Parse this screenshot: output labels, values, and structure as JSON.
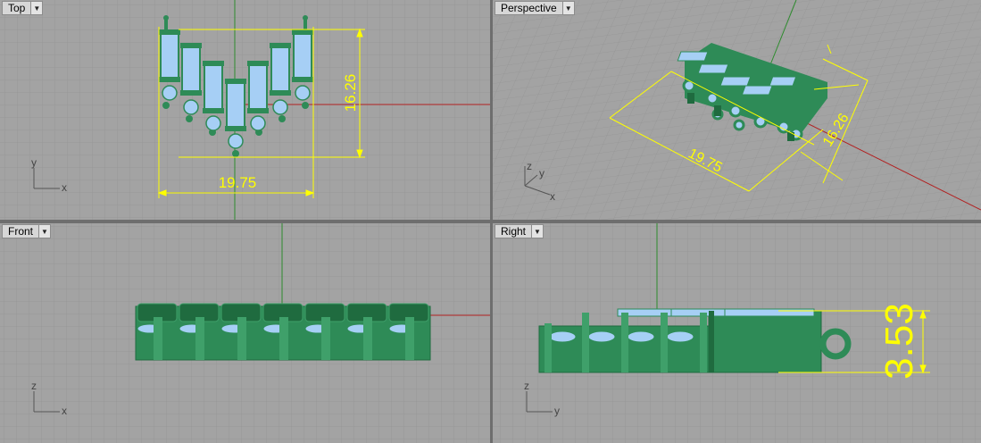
{
  "viewports": {
    "top": {
      "label": "Top",
      "dim_width": "19.75",
      "dim_depth": "16.26",
      "axis_x": "x",
      "axis_y": "y"
    },
    "perspective": {
      "label": "Perspective",
      "dim_width": "19.75",
      "dim_depth": "16.26",
      "axis_x": "x",
      "axis_y": "y",
      "axis_z": "z"
    },
    "front": {
      "label": "Front",
      "axis_x": "x",
      "axis_z": "z"
    },
    "right": {
      "label": "Right",
      "dim_height": "3.53",
      "axis_y": "y",
      "axis_z": "z"
    }
  },
  "colors": {
    "viewport_bg": "#a3a3a3",
    "grid": "#959595",
    "model_green": "#2e8b57",
    "selected_blue": "#a6cff5",
    "dimension_yellow": "#ffff00",
    "x_axis": "#b22222",
    "y_axis": "#2e8b2e"
  },
  "icons": [
    "dropdown-arrow-icon"
  ]
}
